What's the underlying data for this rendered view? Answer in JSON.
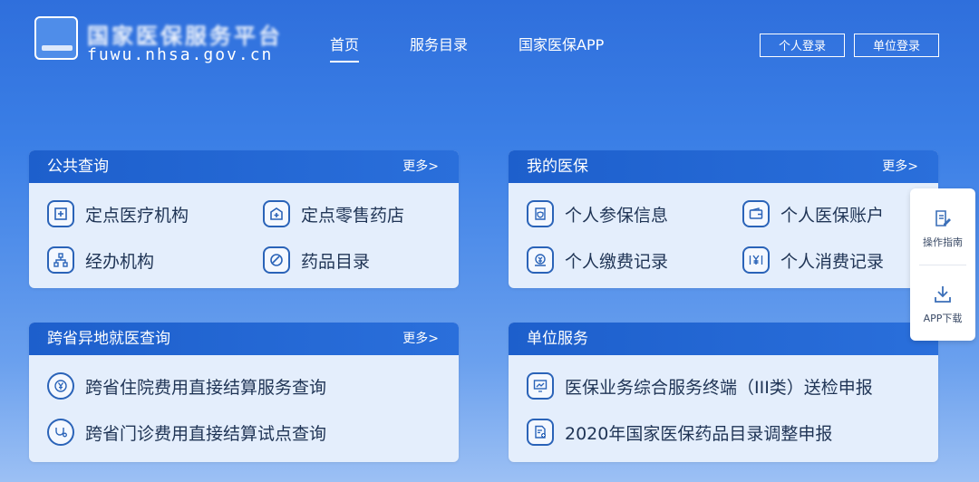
{
  "header": {
    "site_title": "国家医保服务平台",
    "domain": "fuwu.nhsa.gov.cn",
    "nav": [
      {
        "label": "首页",
        "active": true
      },
      {
        "label": "服务目录",
        "active": false
      },
      {
        "label": "国家医保APP",
        "active": false
      }
    ],
    "personal_login": "个人登录",
    "unit_login": "单位登录"
  },
  "cards": {
    "public_query": {
      "title": "公共查询",
      "more": "更多>",
      "items": [
        {
          "label": "定点医疗机构",
          "icon": "hospital-icon"
        },
        {
          "label": "定点零售药店",
          "icon": "pharmacy-icon"
        },
        {
          "label": "经办机构",
          "icon": "org-chart-icon"
        },
        {
          "label": "药品目录",
          "icon": "pill-icon"
        }
      ]
    },
    "my_insurance": {
      "title": "我的医保",
      "more": "更多>",
      "items": [
        {
          "label": "个人参保信息",
          "icon": "shield-doc-icon"
        },
        {
          "label": "个人医保账户",
          "icon": "wallet-icon"
        },
        {
          "label": "个人缴费记录",
          "icon": "payment-icon"
        },
        {
          "label": "个人消费记录",
          "icon": "yuan-receipt-icon"
        }
      ]
    },
    "cross_province": {
      "title": "跨省异地就医查询",
      "more": "更多>",
      "items": [
        {
          "label": "跨省住院费用直接结算服务查询",
          "icon": "yuan-badge-icon"
        },
        {
          "label": "跨省门诊费用直接结算试点查询",
          "icon": "stethoscope-icon"
        }
      ]
    },
    "unit_service": {
      "title": "单位服务",
      "items": [
        {
          "label": "医保业务综合服务终端（III类）送检申报",
          "icon": "monitor-chart-icon"
        },
        {
          "label": "2020年国家医保药品目录调整申报",
          "icon": "doc-plus-icon"
        }
      ]
    }
  },
  "side_panel": {
    "guide": "操作指南",
    "download": "APP下载"
  },
  "colors": {
    "brand_blue": "#2a6fdb",
    "card_bg": "#e4eefc",
    "icon_stroke": "#2a63b8"
  }
}
